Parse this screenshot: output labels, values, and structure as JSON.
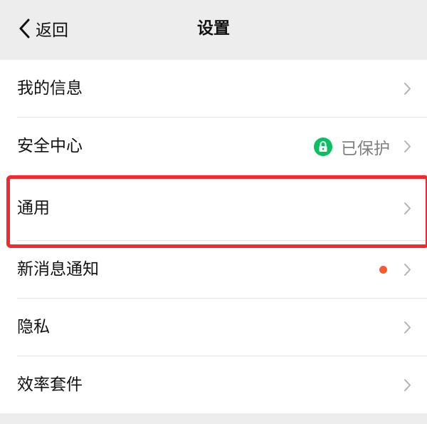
{
  "nav": {
    "back_label": "返回",
    "title": "设置"
  },
  "settings": {
    "items": [
      {
        "label": "我的信息"
      },
      {
        "label": "安全中心",
        "status": "已保护",
        "status_icon": "lock-icon",
        "status_color": "#07c160"
      },
      {
        "label": "通用",
        "highlighted": true,
        "highlight_color": "#f02a2e"
      },
      {
        "label": "新消息通知",
        "badge": "dot",
        "badge_color": "#fa5b2a"
      },
      {
        "label": "隐私"
      },
      {
        "label": "效率套件"
      }
    ]
  },
  "colors": {
    "background": "#ededed",
    "row_background": "#ffffff",
    "text": "#111111",
    "secondary_text": "#7f7f7f"
  }
}
